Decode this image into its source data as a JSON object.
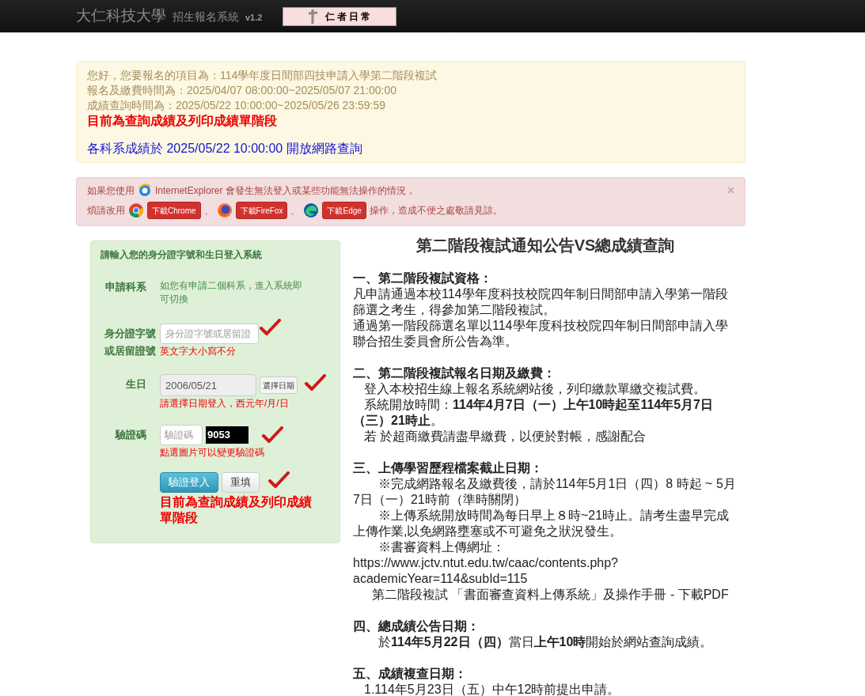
{
  "header": {
    "school": "大仁科技大學",
    "system": "招生報名系統",
    "version": "v1.2",
    "banner": "仁者日常"
  },
  "info_alert": {
    "lines": [
      {
        "kind": "muted",
        "text": "您好，您要報名的項目為：114學年度日間部四技申請入學第二階段複試"
      },
      {
        "kind": "muted",
        "text": "報名及繳費時間為：2025/04/07 08:00:00~2025/05/07 21:00:00"
      },
      {
        "kind": "muted",
        "text": "成績查詢時間為：2025/05/22 10:00:00~2025/05/26 23:59:59"
      },
      {
        "kind": "alert",
        "text": "目前為查詢成績及列印成績單階段"
      },
      {
        "kind": "notice",
        "text": "各科系成績於 2025/05/22 10:00:00 開放網路查詢"
      }
    ]
  },
  "browser_alert": {
    "line1_before": "如果您使用",
    "ie": "InternetExplorer",
    "line1_after": "會發生無法登入或某些功能無法操作的情況，",
    "line2_before": "煩請改用",
    "downloads": [
      {
        "kind": "chrome",
        "label": "下載Chrome"
      },
      {
        "kind": "firefox",
        "label": "下載FireFox"
      },
      {
        "kind": "edge",
        "label": "下載Edge"
      }
    ],
    "separator": "、",
    "line2_after": "操作，造成不便之處敬請見諒。",
    "close": "×"
  },
  "login": {
    "title": "請輸入您的身分證字號和生日登入系統",
    "dept_label": "申請科系",
    "dept_text": "如您有申請二個科系，進入系統即可切換",
    "id_label": "身分證字號或居留證號",
    "id_placeholder": "身分證字號或居留證",
    "id_hint": "英文字大小寫不分",
    "birth_label": "生日",
    "birth_value": "2006/05/21",
    "birth_button": "選擇日期",
    "birth_hint": "請選擇日期登入，西元年/月/日",
    "captcha_label": "驗證碼",
    "captcha_placeholder": "驗證碼",
    "captcha_image": "9053",
    "captcha_hint": "點選圖片可以變更驗證碼",
    "submit": "驗證登入",
    "reset": "重填",
    "status": "目前為查詢成績及列印成績單階段"
  },
  "notice": {
    "title": "第二階段複試通知公告VS總成績查詢",
    "sections": [
      {
        "heading": "一、第二階段複試資格：",
        "paragraphs": [
          {
            "kind": "plain",
            "text": "凡申請通過本校114學年度科技校院四年制日間部申請入學第一階段篩選之考生，得參加第二階段複試。"
          },
          {
            "kind": "plain",
            "text": "通過第一階段篩選名單以114學年度科技校院四年制日間部申請入學聯合招生委員會所公告為準。"
          }
        ]
      },
      {
        "heading": "二、第二階段複試報名日期及繳費：",
        "paragraphs": [
          {
            "kind": "small",
            "text": "登入本校招生線上報名系統網站後，列印繳款單繳交複試費。"
          },
          {
            "kind": "small",
            "text": "系統開放時間：**114年4月7日（一）上午10時起至114年5月7日（三）21時止**。"
          },
          {
            "kind": "small",
            "text": "若 於超商繳費請盡早繳費，以便於對帳，感謝配合"
          }
        ]
      },
      {
        "heading": "三、上傳學習歷程檔案截止日期：",
        "paragraphs": [
          {
            "kind": "deep",
            "text": "※完成網路報名及繳費後，請於114年5月1日（四）8 時起 ~ 5月7日（一）21時前（準時關閉）"
          },
          {
            "kind": "deep",
            "text": "※上傳系統開放時間為每日早上８時~21時止。請考生盡早完成上傳作業,以免網路壅塞或不可避免之狀況發生。"
          },
          {
            "kind": "deep",
            "text": "※書審資料上傳網址："
          },
          {
            "kind": "plain",
            "text": "https://www.jctv.ntut.edu.tw/caac/contents.php?academicYear=114&subId=115"
          },
          {
            "kind": "medium",
            "text": "第二階段複試 「書面審查資料上傳系統」及操作手冊 - 下載PDF"
          }
        ]
      },
      {
        "heading": "四、總成績公告日期：",
        "paragraphs": [
          {
            "kind": "deep",
            "text": "於**114年5月22日（四）**當日**上午10時**開始於網站查詢成績。"
          }
        ]
      },
      {
        "heading": "五、成績複查日期：",
        "paragraphs": [
          {
            "kind": "small",
            "text": "1.114年5月23日（五）中午12時前提出申請。"
          }
        ]
      }
    ]
  }
}
